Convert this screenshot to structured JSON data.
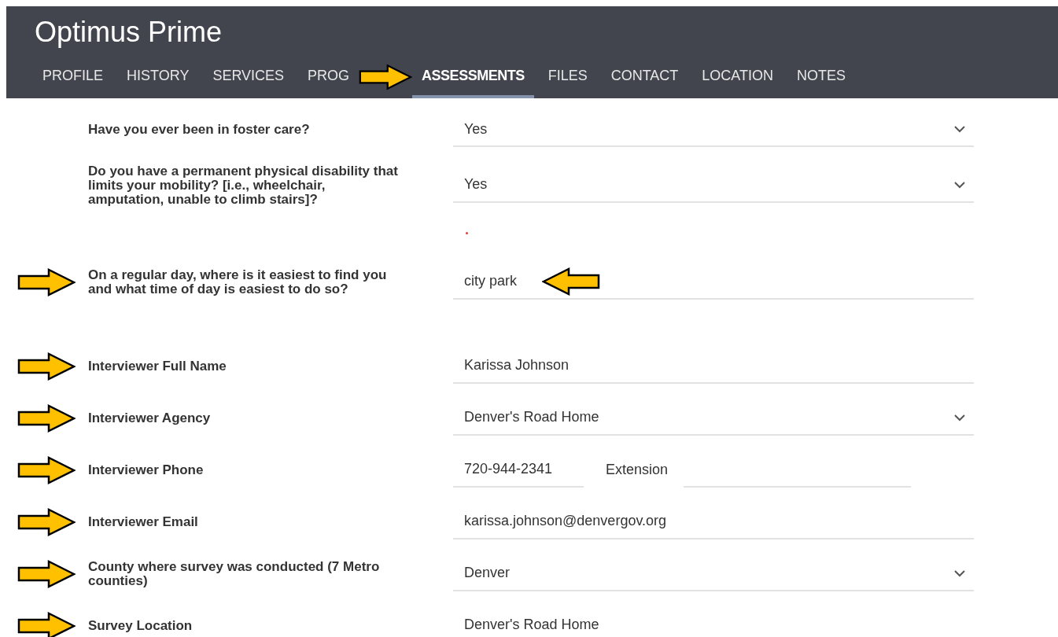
{
  "header": {
    "title": "Optimus Prime"
  },
  "tabs": [
    {
      "label": "PROFILE",
      "selected": false,
      "marked": false
    },
    {
      "label": "HISTORY",
      "selected": false,
      "marked": false
    },
    {
      "label": "SERVICES",
      "selected": false,
      "marked": false
    },
    {
      "label": "PROG",
      "selected": false,
      "marked": false
    },
    {
      "label": "ASSESSMENTS",
      "selected": true,
      "marked": true
    },
    {
      "label": "FILES",
      "selected": false,
      "marked": false
    },
    {
      "label": "CONTACT",
      "selected": false,
      "marked": false
    },
    {
      "label": "LOCATION",
      "selected": false,
      "marked": false
    },
    {
      "label": "NOTES",
      "selected": false,
      "marked": false
    }
  ],
  "rows": [
    {
      "kind": "select",
      "label": "Have you ever been in foster care?",
      "value": "Yes",
      "marked": false
    },
    {
      "kind": "select",
      "label": "Do you have a permanent physical disability that limits your mobility? [i.e., wheelchair, amputation, unable to climb stairs]?",
      "value": "Yes",
      "marked": false
    },
    {
      "kind": "text",
      "label": "On a regular day, where is it easiest to find you and what time of day is easiest to do so?",
      "value": "city park",
      "marked": true,
      "required": true,
      "value_marked": true
    },
    {
      "kind": "text",
      "label": "Interviewer Full Name",
      "value": "Karissa Johnson",
      "marked": true
    },
    {
      "kind": "select",
      "label": "Interviewer Agency",
      "value": "Denver's Road Home",
      "marked": true
    },
    {
      "kind": "phone",
      "label": "Interviewer Phone",
      "value": "720-944-2341",
      "extension_label": "Extension",
      "marked": true
    },
    {
      "kind": "text",
      "label": "Interviewer Email",
      "value": "karissa.johnson@denvergov.org",
      "marked": true
    },
    {
      "kind": "select",
      "label": "County where survey was conducted (7 Metro counties)",
      "value": "Denver",
      "marked": true
    },
    {
      "kind": "text",
      "label": "Survey Location",
      "value": "Denver's Road Home",
      "marked": true
    }
  ]
}
